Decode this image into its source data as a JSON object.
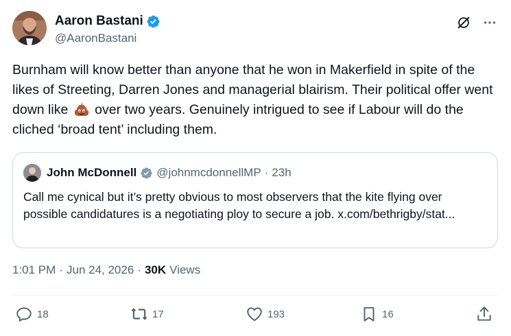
{
  "author": {
    "display_name": "Aaron Bastani",
    "handle": "@AaronBastani",
    "verified": true
  },
  "tweet": {
    "text_before_emoji": "Burnham will know better than anyone that he won in Makerfield in spite of the likes of Streeting, Darren Jones and managerial blairism. Their political offer went down like",
    "emoji": "pile-of-poo-icon",
    "text_after_emoji": " over two years.  Genuinely intrigued to see if Labour will do the cliched ‘broad tent’ including them."
  },
  "quote": {
    "display_name": "John McDonnell",
    "handle": "@johnmcdonnellMP",
    "separator": "·",
    "time": "23h",
    "text": "Call me cynical but it’s pretty obvious to most observers that the kite flying over possible candidatures is a negotiating ploy to secure a job. x.com/bethrigby/stat..."
  },
  "meta": {
    "time": "1:01 PM",
    "separator": "·",
    "date": "Jun 24, 2026",
    "separator2": "·",
    "views_count": "30K",
    "views_label": "Views"
  },
  "actions": {
    "replies": "18",
    "reposts": "17",
    "likes": "193",
    "bookmarks": "16"
  },
  "colors": {
    "verified": "#1d9bf0",
    "muted": "#536471",
    "text": "#0f1419",
    "border": "#cfd9de"
  }
}
